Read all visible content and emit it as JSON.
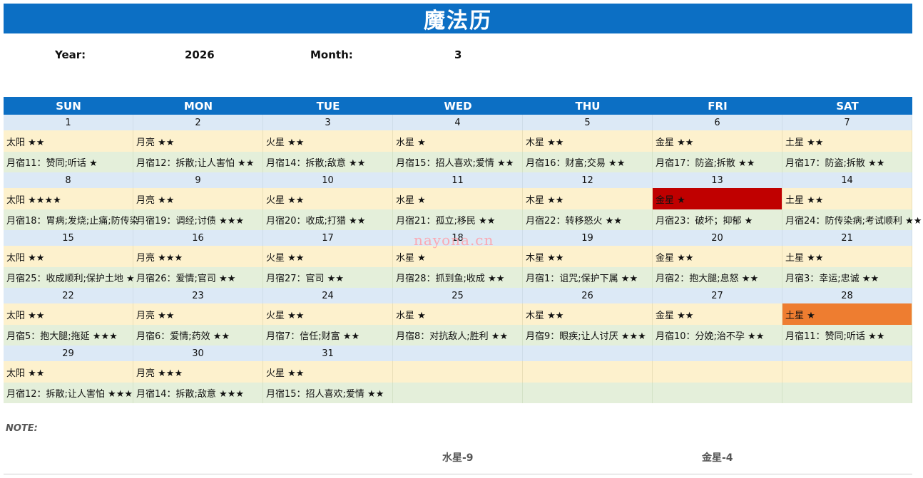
{
  "title": "魔法历",
  "header": {
    "year_label": "Year:",
    "year": "2026",
    "month_label": "Month:",
    "month": "3"
  },
  "weekdays": [
    "SUN",
    "MON",
    "TUE",
    "WED",
    "THU",
    "FRI",
    "SAT"
  ],
  "weeks": [
    [
      {
        "day": "1",
        "planet": "太阳 ★★",
        "mansion": "月宿11：赞同;听话 ★",
        "hl": ""
      },
      {
        "day": "2",
        "planet": "月亮 ★★",
        "mansion": "月宿12：拆散;让人害怕 ★★",
        "hl": ""
      },
      {
        "day": "3",
        "planet": "火星 ★★",
        "mansion": "月宿14：拆散;敌意 ★★",
        "hl": ""
      },
      {
        "day": "4",
        "planet": "水星 ★",
        "mansion": "月宿15：招人喜欢;爱情 ★★",
        "hl": ""
      },
      {
        "day": "5",
        "planet": "木星 ★★",
        "mansion": "月宿16：财富;交易 ★★",
        "hl": ""
      },
      {
        "day": "6",
        "planet": "金星 ★★",
        "mansion": "月宿17：防盗;拆散 ★★",
        "hl": ""
      },
      {
        "day": "7",
        "planet": "土星 ★★",
        "mansion": "月宿17：防盗;拆散 ★★",
        "hl": ""
      }
    ],
    [
      {
        "day": "8",
        "planet": "太阳 ★★★★",
        "mansion": "月宿18：胃病;发烧;止痛;防传染",
        "hl": ""
      },
      {
        "day": "9",
        "planet": "月亮 ★★",
        "mansion": "月宿19：调经;讨债 ★★★",
        "hl": ""
      },
      {
        "day": "10",
        "planet": "火星 ★★",
        "mansion": "月宿20：收成;打猎 ★★",
        "hl": ""
      },
      {
        "day": "11",
        "planet": "水星 ★",
        "mansion": "月宿21：孤立;移民 ★★",
        "hl": ""
      },
      {
        "day": "12",
        "planet": "木星 ★★",
        "mansion": "月宿22：转移怒火 ★★",
        "hl": ""
      },
      {
        "day": "13",
        "planet": "金星 ★",
        "mansion": "月宿23：破坏；抑郁 ★",
        "hl": "red"
      },
      {
        "day": "14",
        "planet": "土星 ★★",
        "mansion": "月宿24：防传染病;考试顺利 ★★",
        "hl": ""
      }
    ],
    [
      {
        "day": "15",
        "planet": "太阳 ★★",
        "mansion": "月宿25：收成顺利;保护土地 ★",
        "hl": ""
      },
      {
        "day": "16",
        "planet": "月亮 ★★★",
        "mansion": "月宿26：爱情;官司 ★★",
        "hl": ""
      },
      {
        "day": "17",
        "planet": "火星 ★★",
        "mansion": "月宿27：官司 ★★",
        "hl": ""
      },
      {
        "day": "18",
        "planet": "水星 ★",
        "mansion": "月宿28：抓到鱼;收成 ★★",
        "hl": ""
      },
      {
        "day": "19",
        "planet": "木星 ★★",
        "mansion": "月宿1：诅咒;保护下属 ★★",
        "hl": ""
      },
      {
        "day": "20",
        "planet": "金星 ★★",
        "mansion": "月宿2：抱大腿;息怒 ★★",
        "hl": ""
      },
      {
        "day": "21",
        "planet": "土星 ★★",
        "mansion": "月宿3：幸运;忠诚 ★★",
        "hl": ""
      }
    ],
    [
      {
        "day": "22",
        "planet": "太阳 ★★",
        "mansion": "月宿5：抱大腿;拖延 ★★★",
        "hl": ""
      },
      {
        "day": "23",
        "planet": "月亮 ★★",
        "mansion": "月宿6：爱情;药效 ★★",
        "hl": ""
      },
      {
        "day": "24",
        "planet": "火星 ★★",
        "mansion": "月宿7：信任;财富 ★★",
        "hl": ""
      },
      {
        "day": "25",
        "planet": "水星 ★",
        "mansion": "月宿8：对抗敌人;胜利 ★★",
        "hl": ""
      },
      {
        "day": "26",
        "planet": "木星 ★★",
        "mansion": "月宿9：眼疾;让人讨厌 ★★★",
        "hl": ""
      },
      {
        "day": "27",
        "planet": "金星 ★★",
        "mansion": "月宿10：分娩;治不孕 ★★",
        "hl": ""
      },
      {
        "day": "28",
        "planet": "土星 ★",
        "mansion": "月宿11：赞同;听话 ★★",
        "hl": "orange"
      }
    ],
    [
      {
        "day": "29",
        "planet": "太阳 ★★",
        "mansion": "月宿12：拆散;让人害怕 ★★★",
        "hl": ""
      },
      {
        "day": "30",
        "planet": "月亮 ★★★",
        "mansion": "月宿14：拆散;敌意 ★★★",
        "hl": ""
      },
      {
        "day": "31",
        "planet": "火星 ★★",
        "mansion": "月宿15：招人喜欢;爱情 ★★",
        "hl": ""
      },
      {
        "day": "",
        "planet": "",
        "mansion": "",
        "hl": ""
      },
      {
        "day": "",
        "planet": "",
        "mansion": "",
        "hl": ""
      },
      {
        "day": "",
        "planet": "",
        "mansion": "",
        "hl": ""
      },
      {
        "day": "",
        "planet": "",
        "mansion": "",
        "hl": ""
      }
    ]
  ],
  "note_label": "NOTE:",
  "legend": [
    "水星-9",
    "金星-4"
  ],
  "watermark": "nayona.cn",
  "colors": {
    "header_blue": "#0c6fc4",
    "day_row": "#dce9f6",
    "planet_row": "#fdf1cd",
    "mansion_row": "#e4efda",
    "highlight_red": "#c00000",
    "highlight_orange": "#ee7d30"
  }
}
